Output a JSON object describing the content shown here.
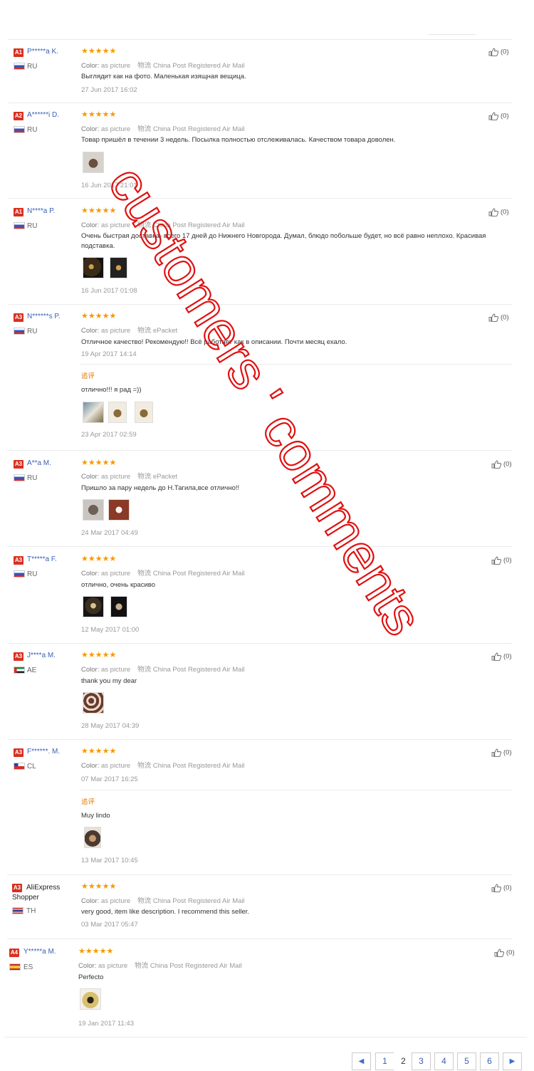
{
  "like_icon": "thumbs-up-icon",
  "add_label": "追评",
  "reviews": [
    {
      "badge": "A1",
      "name": "P*****a K.",
      "country": "RU",
      "flag": "ru",
      "color_label": "Color:",
      "color": "as picture",
      "ship_label": "物流",
      "ship": "China Post Registered Air Mail",
      "text": "Выглядит как на фото. Маленькая изящная вещица.",
      "date": "27 Jun 2017 16:02",
      "likes": "(0)"
    },
    {
      "badge": "A2",
      "name": "A******i D.",
      "country": "RU",
      "flag": "ru",
      "color_label": "Color:",
      "color": "as picture",
      "ship_label": "物流",
      "ship": "China Post Registered Air Mail",
      "text": "Товар пришёл в течении 3 недель. Посылка полностью отслеживалась. Качеством товара доволен.",
      "date": "16 Jun 2017 21:01",
      "likes": "(0)"
    },
    {
      "badge": "A1",
      "name": "N****a P.",
      "country": "RU",
      "flag": "ru",
      "color_label": "Color:",
      "color": "as picture",
      "ship_label": "物流",
      "ship": "China Post Registered Air Mail",
      "text": "Очень быстрая доставка- всего 17 дней до Нижнего Новгорода. Думал, блюдо побольше будет, но всё равно неплохо. Красивая подставка.",
      "date": "16 Jun 2017 01:08",
      "likes": "(0)"
    },
    {
      "badge": "A3",
      "name": "N******s P.",
      "country": "RU",
      "flag": "ru",
      "color_label": "Color:",
      "color": "as picture",
      "ship_label": "物流",
      "ship": "ePacket",
      "text": "Отличное качество! Рекомендую!! Всё работает как в описании. Почти месяц ехало.",
      "date": "19 Apr 2017 14:14",
      "likes": "(0)",
      "followup_text": "отлично!!! я рад =))",
      "followup_date": "23 Apr 2017 02:59"
    },
    {
      "badge": "A3",
      "name": "A**a M.",
      "country": "RU",
      "flag": "ru",
      "color_label": "Color:",
      "color": "as picture",
      "ship_label": "物流",
      "ship": "ePacket",
      "text": "Пришло за пару недель до Н.Тагила,все отлично!!",
      "date": "24 Mar 2017 04:49",
      "likes": "(0)"
    },
    {
      "badge": "A3",
      "name": "T*****a F.",
      "country": "RU",
      "flag": "ru",
      "color_label": "Color:",
      "color": "as picture",
      "ship_label": "物流",
      "ship": "China Post Registered Air Mail",
      "text": "отлично, очень красиво",
      "date": "12 May 2017 01:00",
      "likes": "(0)"
    },
    {
      "badge": "A3",
      "name": "J****a M.",
      "country": "AE",
      "flag": "ae",
      "color_label": "Color:",
      "color": "as picture",
      "ship_label": "物流",
      "ship": "China Post Registered Air Mail",
      "text": "thank you my dear",
      "date": "28 May 2017 04:39",
      "likes": "(0)"
    },
    {
      "badge": "A3",
      "name": "F******. M.",
      "country": "CL",
      "flag": "cl",
      "color_label": "Color:",
      "color": "as picture",
      "ship_label": "物流",
      "ship": "China Post Registered Air Mail",
      "text": "",
      "date": "07 Mar 2017 16:25",
      "likes": "(0)",
      "followup_text": "Muy lindo",
      "followup_date": "13 Mar 2017 10:45"
    },
    {
      "badge": "A3",
      "name": "AliExpress Shopper",
      "country": "TH",
      "flag": "th",
      "color_label": "Color:",
      "color": "as picture",
      "ship_label": "物流",
      "ship": "China Post Registered Air Mail",
      "text": "very good, item like description. I recommend this seller.",
      "date": "03 Mar 2017 05:47",
      "likes": "(0)"
    },
    {
      "badge": "A4",
      "name": "Y*****a M.",
      "country": "ES",
      "flag": "es",
      "color_label": "Color:",
      "color": "as picture",
      "ship_label": "物流",
      "ship": "China Post Registered Air Mail",
      "text": "Perfecto",
      "date": "19 Jan 2017 11:43",
      "likes": "(0)"
    }
  ],
  "stars": "★★★★★",
  "watermark": "customers ' comments",
  "pagination": {
    "prev": "◀",
    "pages": [
      "1",
      "2",
      "3",
      "4",
      "5",
      "6"
    ],
    "current": "2",
    "next": "▶"
  }
}
